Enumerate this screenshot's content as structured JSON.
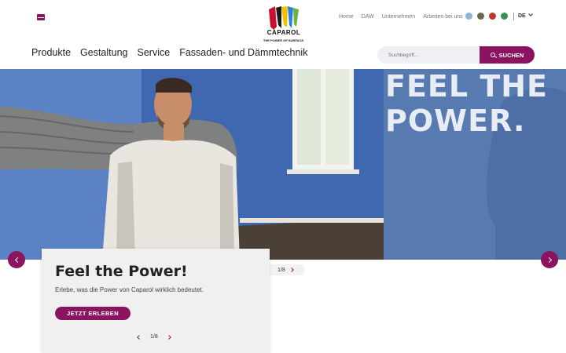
{
  "header": {
    "mail_icon": "envelope-icon",
    "logo": {
      "brand": "CAPAROL",
      "claim": "THE POWER OF SURFACE."
    },
    "top_links": [
      "Home",
      "DAW",
      "Unternehmen",
      "Arbeiten bei uns"
    ],
    "socials": [
      {
        "name": "circle-social-icon",
        "color": "#8fb3d8"
      },
      {
        "name": "dark-social-icon",
        "color": "#6a6a4a"
      },
      {
        "name": "red-social-icon",
        "color": "#c0392b"
      },
      {
        "name": "green-social-icon",
        "color": "#3e8e5a"
      }
    ],
    "language": "DE"
  },
  "mainnav": [
    "Produkte",
    "Gestaltung",
    "Service",
    "Fassaden- und Dämmtechnik"
  ],
  "search": {
    "placeholder": "Suchbegriff...",
    "button_label": "SUCHEN"
  },
  "hero": {
    "headline_line1": "FEEL THE",
    "headline_line2": "POWER."
  },
  "carousel": {
    "pager": "1/8",
    "card_title": "Feel the Power!",
    "card_text": "Erlebe, was die Power von Caparol wirklich bedeutet.",
    "cta_label": "JETZT ERLEBEN",
    "card_pager": "1/8"
  },
  "colors": {
    "accent": "#8a1460",
    "hero_blue": "#4a6fa8"
  }
}
